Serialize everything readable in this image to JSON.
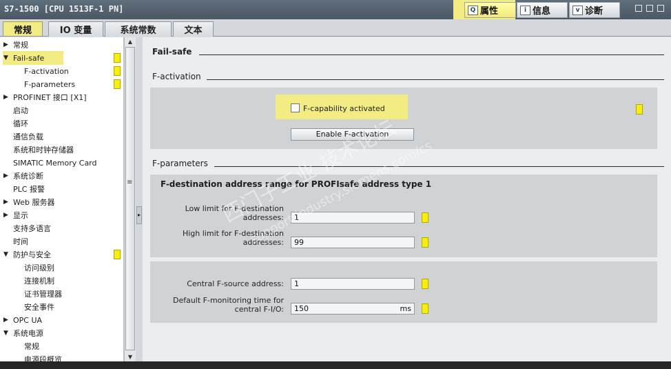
{
  "window": {
    "title": "S7-1500 [CPU 1513F-1 PN]",
    "inspector_tabs": [
      {
        "icon": "Q",
        "label": "属性",
        "active": true
      },
      {
        "icon": "i",
        "label": "信息",
        "active": false
      },
      {
        "icon": "v",
        "label": "诊断",
        "active": false
      }
    ]
  },
  "tabs": [
    {
      "label": "常规",
      "active": true
    },
    {
      "label": "IO 变量",
      "active": false
    },
    {
      "label": "系统常数",
      "active": false
    },
    {
      "label": "文本",
      "active": false
    }
  ],
  "nav": {
    "items": [
      {
        "label": "常规",
        "level": 0,
        "arrow": "▶",
        "mark": false
      },
      {
        "label": "Fail-safe",
        "level": 0,
        "arrow": "▼",
        "mark": true
      },
      {
        "label": "F-activation",
        "level": 1,
        "arrow": "",
        "mark": true
      },
      {
        "label": "F-parameters",
        "level": 1,
        "arrow": "",
        "mark": true
      },
      {
        "label": "PROFINET 接口 [X1]",
        "level": 0,
        "arrow": "▶",
        "mark": false
      },
      {
        "label": "启动",
        "level": 0,
        "arrow": "",
        "mark": false
      },
      {
        "label": "循环",
        "level": 0,
        "arrow": "",
        "mark": false
      },
      {
        "label": "通信负载",
        "level": 0,
        "arrow": "",
        "mark": false
      },
      {
        "label": "系统和时钟存储器",
        "level": 0,
        "arrow": "",
        "mark": false
      },
      {
        "label": "SIMATIC Memory Card",
        "level": 0,
        "arrow": "",
        "mark": false
      },
      {
        "label": "系统诊断",
        "level": 0,
        "arrow": "▶",
        "mark": false
      },
      {
        "label": "PLC 报警",
        "level": 0,
        "arrow": "",
        "mark": false
      },
      {
        "label": "Web 服务器",
        "level": 0,
        "arrow": "▶",
        "mark": false
      },
      {
        "label": "显示",
        "level": 0,
        "arrow": "▶",
        "mark": false
      },
      {
        "label": "支持多语言",
        "level": 0,
        "arrow": "",
        "mark": false
      },
      {
        "label": "时间",
        "level": 0,
        "arrow": "",
        "mark": false
      },
      {
        "label": "防护与安全",
        "level": 0,
        "arrow": "▼",
        "mark": true
      },
      {
        "label": "访问级别",
        "level": 1,
        "arrow": "",
        "mark": false
      },
      {
        "label": "连接机制",
        "level": 1,
        "arrow": "",
        "mark": false
      },
      {
        "label": "证书管理器",
        "level": 1,
        "arrow": "",
        "mark": false
      },
      {
        "label": "安全事件",
        "level": 1,
        "arrow": "",
        "mark": false
      },
      {
        "label": "OPC UA",
        "level": 0,
        "arrow": "▶",
        "mark": false
      },
      {
        "label": "系统电源",
        "level": 0,
        "arrow": "▼",
        "mark": false
      },
      {
        "label": "常规",
        "level": 1,
        "arrow": "",
        "mark": false
      },
      {
        "label": "电源段概览",
        "level": 1,
        "arrow": "",
        "mark": false
      }
    ]
  },
  "content": {
    "fail_safe_title": "Fail-safe",
    "f_activation_title": "F-activation",
    "f_capability_label": "F-capability activated",
    "f_capability_checked": false,
    "enable_button": "Enable F-activation",
    "f_parameters_title": "F-parameters",
    "dest_range_title": "F-destination address range for PROFIsafe address type 1",
    "low_limit_label_1": "Low limit for F-destination",
    "low_limit_label_2": "addresses:",
    "low_limit_value": "1",
    "high_limit_label_1": "High limit for F-destination",
    "high_limit_label_2": "addresses:",
    "high_limit_value": "99",
    "central_source_label": "Central F-source address:",
    "central_source_value": "1",
    "monitoring_label_1": "Default F-monitoring time for",
    "monitoring_label_2": "central F-I/O:",
    "monitoring_value": "150",
    "monitoring_unit": "ms"
  },
  "watermark": {
    "line1": "西门子工业   技术论坛",
    "line2": "support.industry.siemens.com/cs"
  },
  "colors": {
    "highlight": "#f2ec82",
    "marker": "#f7f000",
    "titlebar": "#4a5864"
  }
}
